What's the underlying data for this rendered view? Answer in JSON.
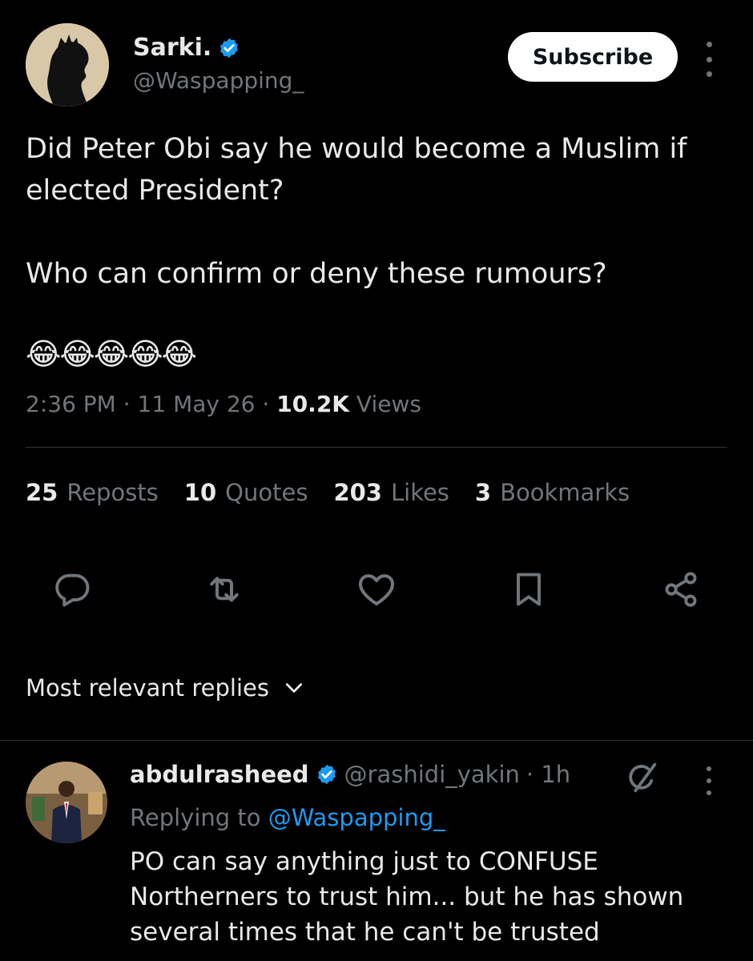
{
  "tweet": {
    "author_name": "Sarki.",
    "handle": "@Waspapping_",
    "subscribe_label": "Subscribe",
    "text": "Did Peter Obi say he would become a Muslim if\nelected President?\n\nWho can confirm or deny these rumours?",
    "emojis": "😂😂😂😂😂",
    "time": "2:36 PM",
    "date": "11 May 26",
    "views_count": "10.2K",
    "views_label": "Views"
  },
  "stats": [
    {
      "count": "25",
      "label": "Reposts"
    },
    {
      "count": "10",
      "label": "Quotes"
    },
    {
      "count": "203",
      "label": "Likes"
    },
    {
      "count": "3",
      "label": "Bookmarks"
    }
  ],
  "icons": {
    "verified": "verified-badge-icon",
    "reply": "reply-icon",
    "repost": "repost-icon",
    "like": "heart-icon",
    "bookmark": "bookmark-icon",
    "share": "share-icon",
    "grok": "grok-icon",
    "more": "more-icon",
    "chevron": "chevron-down-icon"
  },
  "replies_sort": {
    "label": "Most relevant replies"
  },
  "reply": {
    "author_name": "abdulrasheed",
    "handle": "@rashidi_yakin",
    "age": "· 1h",
    "replying_prefix": "Replying to",
    "replying_to": "@Waspapping_",
    "text": "PO can say anything just to CONFUSE\nNortherners to trust him... but he has shown\nseveral times that he can't be trusted"
  },
  "colors": {
    "background": "#000000",
    "text": "#e7e9ea",
    "muted": "#71767b",
    "accent": "#1d9bf0",
    "divider": "#2f3336"
  }
}
